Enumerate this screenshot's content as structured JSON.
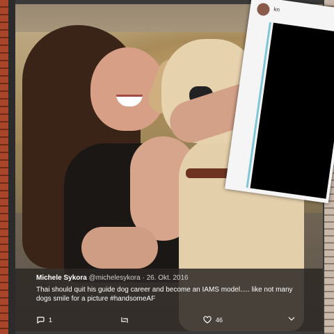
{
  "tweet": {
    "display_name": "Michele Sykora",
    "handle": "@michelesykora",
    "separator": "·",
    "date": "26. Okt. 2016",
    "text": "Thai should quit his guide dog career and become an IAMS model..... like not many dogs smile for a picture #handsomeAF",
    "replies_count": "1",
    "likes_count": "46"
  },
  "overlay": {
    "partial_text": "kn"
  },
  "icons": {
    "reply": "reply-icon",
    "retweet": "retweet-icon",
    "like": "heart-icon",
    "more": "chevron-down-icon"
  },
  "colors": {
    "card_bg": "#2f2a26",
    "text": "#ffffff",
    "meta": "#d0d0d0"
  }
}
